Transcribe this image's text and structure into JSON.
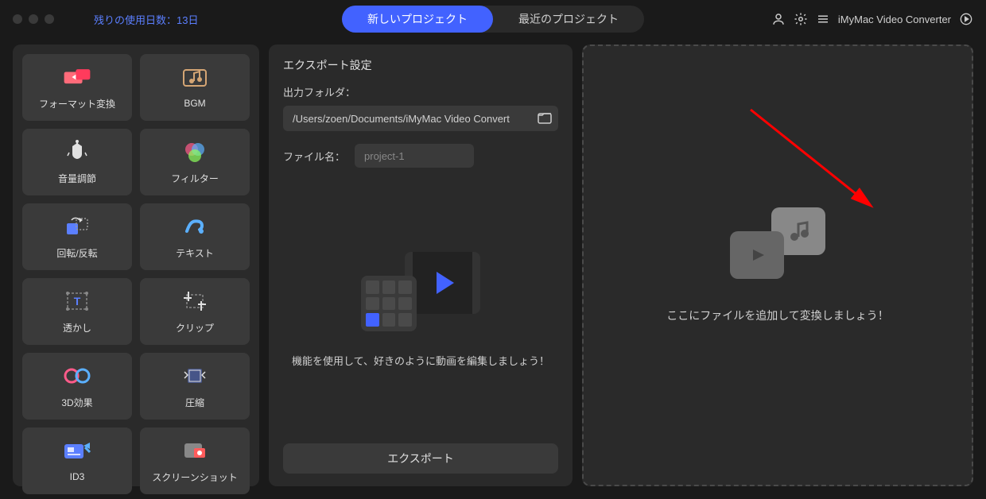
{
  "header": {
    "trial_text": "残りの使用日数：13日",
    "tabs": {
      "new": "新しいプロジェクト",
      "recent": "最近のプロジェクト"
    },
    "app_name": "iMyMac Video Converter"
  },
  "tools": [
    {
      "label": "フォーマット変換",
      "icon": "format-convert-icon"
    },
    {
      "label": "BGM",
      "icon": "bgm-icon"
    },
    {
      "label": "音量調節",
      "icon": "volume-icon"
    },
    {
      "label": "フィルター",
      "icon": "filter-icon"
    },
    {
      "label": "回転/反転",
      "icon": "rotate-icon"
    },
    {
      "label": "テキスト",
      "icon": "text-icon"
    },
    {
      "label": "透かし",
      "icon": "watermark-icon"
    },
    {
      "label": "クリップ",
      "icon": "clip-icon"
    },
    {
      "label": "3D効果",
      "icon": "3d-icon"
    },
    {
      "label": "圧縮",
      "icon": "compress-icon"
    },
    {
      "label": "ID3",
      "icon": "id3-icon"
    },
    {
      "label": "スクリーンショット",
      "icon": "screenshot-icon"
    }
  ],
  "export": {
    "title": "エクスポート設定",
    "folder_label": "出力フォルダ：",
    "folder_path": "/Users/zoen/Documents/iMyMac Video Convert",
    "filename_label": "ファイル名：",
    "filename_value": "project-1",
    "preview_text": "機能を使用して、好きのように動画を編集しましょう！",
    "button": "エクスポート"
  },
  "drop": {
    "text": "ここにファイルを追加して変換しましょう！"
  },
  "colors": {
    "accent": "#4262ff",
    "arrow": "#ff0000"
  }
}
